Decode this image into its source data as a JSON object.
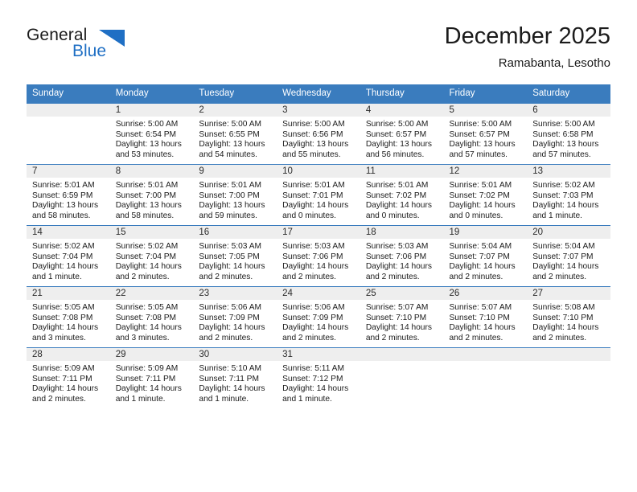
{
  "brand": {
    "name_part1": "General",
    "name_part2": "Blue",
    "triangle_icon": "triangle-logo-icon",
    "color": "#1f6fc4"
  },
  "header": {
    "title": "December 2025",
    "subtitle": "Ramabanta, Lesotho"
  },
  "theme": {
    "header_bg": "#3a7cbe",
    "daynum_bg": "#eeeeee",
    "text": "#1b1b1b",
    "grid_line": "#3a7cbe"
  },
  "weekdays": [
    "Sunday",
    "Monday",
    "Tuesday",
    "Wednesday",
    "Thursday",
    "Friday",
    "Saturday"
  ],
  "weeks": [
    [
      {
        "day": "",
        "blank": true
      },
      {
        "day": "1",
        "sunrise": "Sunrise: 5:00 AM",
        "sunset": "Sunset: 6:54 PM",
        "daylight_l1": "Daylight: 13 hours",
        "daylight_l2": "and 53 minutes."
      },
      {
        "day": "2",
        "sunrise": "Sunrise: 5:00 AM",
        "sunset": "Sunset: 6:55 PM",
        "daylight_l1": "Daylight: 13 hours",
        "daylight_l2": "and 54 minutes."
      },
      {
        "day": "3",
        "sunrise": "Sunrise: 5:00 AM",
        "sunset": "Sunset: 6:56 PM",
        "daylight_l1": "Daylight: 13 hours",
        "daylight_l2": "and 55 minutes."
      },
      {
        "day": "4",
        "sunrise": "Sunrise: 5:00 AM",
        "sunset": "Sunset: 6:57 PM",
        "daylight_l1": "Daylight: 13 hours",
        "daylight_l2": "and 56 minutes."
      },
      {
        "day": "5",
        "sunrise": "Sunrise: 5:00 AM",
        "sunset": "Sunset: 6:57 PM",
        "daylight_l1": "Daylight: 13 hours",
        "daylight_l2": "and 57 minutes."
      },
      {
        "day": "6",
        "sunrise": "Sunrise: 5:00 AM",
        "sunset": "Sunset: 6:58 PM",
        "daylight_l1": "Daylight: 13 hours",
        "daylight_l2": "and 57 minutes."
      }
    ],
    [
      {
        "day": "7",
        "sunrise": "Sunrise: 5:01 AM",
        "sunset": "Sunset: 6:59 PM",
        "daylight_l1": "Daylight: 13 hours",
        "daylight_l2": "and 58 minutes."
      },
      {
        "day": "8",
        "sunrise": "Sunrise: 5:01 AM",
        "sunset": "Sunset: 7:00 PM",
        "daylight_l1": "Daylight: 13 hours",
        "daylight_l2": "and 58 minutes."
      },
      {
        "day": "9",
        "sunrise": "Sunrise: 5:01 AM",
        "sunset": "Sunset: 7:00 PM",
        "daylight_l1": "Daylight: 13 hours",
        "daylight_l2": "and 59 minutes."
      },
      {
        "day": "10",
        "sunrise": "Sunrise: 5:01 AM",
        "sunset": "Sunset: 7:01 PM",
        "daylight_l1": "Daylight: 14 hours",
        "daylight_l2": "and 0 minutes."
      },
      {
        "day": "11",
        "sunrise": "Sunrise: 5:01 AM",
        "sunset": "Sunset: 7:02 PM",
        "daylight_l1": "Daylight: 14 hours",
        "daylight_l2": "and 0 minutes."
      },
      {
        "day": "12",
        "sunrise": "Sunrise: 5:01 AM",
        "sunset": "Sunset: 7:02 PM",
        "daylight_l1": "Daylight: 14 hours",
        "daylight_l2": "and 0 minutes."
      },
      {
        "day": "13",
        "sunrise": "Sunrise: 5:02 AM",
        "sunset": "Sunset: 7:03 PM",
        "daylight_l1": "Daylight: 14 hours",
        "daylight_l2": "and 1 minute."
      }
    ],
    [
      {
        "day": "14",
        "sunrise": "Sunrise: 5:02 AM",
        "sunset": "Sunset: 7:04 PM",
        "daylight_l1": "Daylight: 14 hours",
        "daylight_l2": "and 1 minute."
      },
      {
        "day": "15",
        "sunrise": "Sunrise: 5:02 AM",
        "sunset": "Sunset: 7:04 PM",
        "daylight_l1": "Daylight: 14 hours",
        "daylight_l2": "and 2 minutes."
      },
      {
        "day": "16",
        "sunrise": "Sunrise: 5:03 AM",
        "sunset": "Sunset: 7:05 PM",
        "daylight_l1": "Daylight: 14 hours",
        "daylight_l2": "and 2 minutes."
      },
      {
        "day": "17",
        "sunrise": "Sunrise: 5:03 AM",
        "sunset": "Sunset: 7:06 PM",
        "daylight_l1": "Daylight: 14 hours",
        "daylight_l2": "and 2 minutes."
      },
      {
        "day": "18",
        "sunrise": "Sunrise: 5:03 AM",
        "sunset": "Sunset: 7:06 PM",
        "daylight_l1": "Daylight: 14 hours",
        "daylight_l2": "and 2 minutes."
      },
      {
        "day": "19",
        "sunrise": "Sunrise: 5:04 AM",
        "sunset": "Sunset: 7:07 PM",
        "daylight_l1": "Daylight: 14 hours",
        "daylight_l2": "and 2 minutes."
      },
      {
        "day": "20",
        "sunrise": "Sunrise: 5:04 AM",
        "sunset": "Sunset: 7:07 PM",
        "daylight_l1": "Daylight: 14 hours",
        "daylight_l2": "and 2 minutes."
      }
    ],
    [
      {
        "day": "21",
        "sunrise": "Sunrise: 5:05 AM",
        "sunset": "Sunset: 7:08 PM",
        "daylight_l1": "Daylight: 14 hours",
        "daylight_l2": "and 3 minutes."
      },
      {
        "day": "22",
        "sunrise": "Sunrise: 5:05 AM",
        "sunset": "Sunset: 7:08 PM",
        "daylight_l1": "Daylight: 14 hours",
        "daylight_l2": "and 3 minutes."
      },
      {
        "day": "23",
        "sunrise": "Sunrise: 5:06 AM",
        "sunset": "Sunset: 7:09 PM",
        "daylight_l1": "Daylight: 14 hours",
        "daylight_l2": "and 2 minutes."
      },
      {
        "day": "24",
        "sunrise": "Sunrise: 5:06 AM",
        "sunset": "Sunset: 7:09 PM",
        "daylight_l1": "Daylight: 14 hours",
        "daylight_l2": "and 2 minutes."
      },
      {
        "day": "25",
        "sunrise": "Sunrise: 5:07 AM",
        "sunset": "Sunset: 7:10 PM",
        "daylight_l1": "Daylight: 14 hours",
        "daylight_l2": "and 2 minutes."
      },
      {
        "day": "26",
        "sunrise": "Sunrise: 5:07 AM",
        "sunset": "Sunset: 7:10 PM",
        "daylight_l1": "Daylight: 14 hours",
        "daylight_l2": "and 2 minutes."
      },
      {
        "day": "27",
        "sunrise": "Sunrise: 5:08 AM",
        "sunset": "Sunset: 7:10 PM",
        "daylight_l1": "Daylight: 14 hours",
        "daylight_l2": "and 2 minutes."
      }
    ],
    [
      {
        "day": "28",
        "sunrise": "Sunrise: 5:09 AM",
        "sunset": "Sunset: 7:11 PM",
        "daylight_l1": "Daylight: 14 hours",
        "daylight_l2": "and 2 minutes."
      },
      {
        "day": "29",
        "sunrise": "Sunrise: 5:09 AM",
        "sunset": "Sunset: 7:11 PM",
        "daylight_l1": "Daylight: 14 hours",
        "daylight_l2": "and 1 minute."
      },
      {
        "day": "30",
        "sunrise": "Sunrise: 5:10 AM",
        "sunset": "Sunset: 7:11 PM",
        "daylight_l1": "Daylight: 14 hours",
        "daylight_l2": "and 1 minute."
      },
      {
        "day": "31",
        "sunrise": "Sunrise: 5:11 AM",
        "sunset": "Sunset: 7:12 PM",
        "daylight_l1": "Daylight: 14 hours",
        "daylight_l2": "and 1 minute."
      },
      {
        "day": "",
        "blank": true
      },
      {
        "day": "",
        "blank": true
      },
      {
        "day": "",
        "blank": true
      }
    ]
  ]
}
